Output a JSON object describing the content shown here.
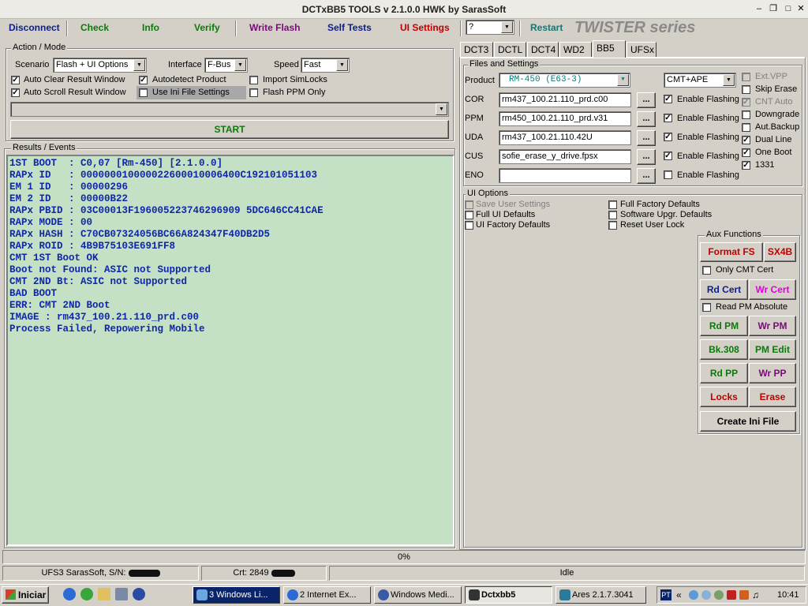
{
  "window": {
    "title": "DCTxBB5 TOOLS v 2.1.0.0 HWK by SarasSoft"
  },
  "toolbar": {
    "disconnect": "Disconnect",
    "check": "Check",
    "info": "Info",
    "verify": "Verify",
    "write_flash": "Write Flash",
    "self_tests": "Self Tests",
    "ui_settings": "UI Settings",
    "select_value": "?",
    "restart": "Restart",
    "brand": "TWISTER series"
  },
  "action_mode": {
    "title": "Action / Mode",
    "scenario_label": "Scenario",
    "scenario_value": "Flash + UI Options",
    "interface_label": "Interface",
    "interface_value": "F-Bus",
    "speed_label": "Speed",
    "speed_value": "Fast",
    "checkboxes": [
      {
        "label": "Auto Clear Result Window",
        "checked": true
      },
      {
        "label": "Autodetect Product",
        "checked": true
      },
      {
        "label": "Import SimLocks",
        "checked": false
      },
      {
        "label": "Auto Scroll Result Window",
        "checked": true
      },
      {
        "label": "Use Ini File Settings",
        "checked": false
      },
      {
        "label": "Flash PPM Only",
        "checked": false
      }
    ],
    "start_label": "START"
  },
  "results": {
    "title": "Results / Events",
    "lines": [
      "1ST BOOT  : C0,07 [Rm-450] [2.1.0.0]",
      "RAPx ID   : 000000010000022600010006400C192101051103",
      "EM 1 ID   : 00000296",
      "EM 2 ID   : 00000B22",
      "RAPx PBID : 03C00013F196005223746296909 5DC646CC41CAE",
      "RAPx MODE : 00",
      "RAPx HASH : C70CB07324056BC66A824347F40DB2D5",
      "RAPx ROID : 4B9B75103E691FF8",
      "CMT 1ST Boot OK",
      "Boot not Found: ASIC not Supported",
      "CMT 2ND Bt: ASIC not Supported",
      "BAD BOOT",
      "ERR: CMT 2ND Boot",
      "IMAGE : rm437_100.21.110_prd.c00",
      "Process Failed, Repowering Mobile"
    ]
  },
  "tabs": [
    "DCT3",
    "DCTL",
    "DCT4",
    "WD2",
    "BB5",
    "UFSx"
  ],
  "files": {
    "title": "Files and Settings",
    "product_label": "Product",
    "product_value": "RM-450  (E63-3)",
    "cmt_value": "CMT+APE",
    "rows": [
      {
        "label": "COR",
        "file": "rm437_100.21.110_prd.c00",
        "flash_label": "Enable Flashing",
        "checked": true
      },
      {
        "label": "PPM",
        "file": "rm450_100.21.110_prd.v31",
        "flash_label": "Enable Flashing",
        "checked": true
      },
      {
        "label": "UDA",
        "file": "rm437_100.21.110.42U",
        "flash_label": "Enable Flashing",
        "checked": true
      },
      {
        "label": "CUS",
        "file": "sofie_erase_y_drive.fpsx",
        "flash_label": "Enable Flashing",
        "checked": true
      },
      {
        "label": "ENO",
        "file": "",
        "flash_label": "Enable Flashing",
        "checked": false
      }
    ],
    "browse": "...",
    "side_options": [
      {
        "label": "Ext.VPP",
        "checked": false,
        "disabled": true
      },
      {
        "label": "Skip Erase",
        "checked": false,
        "disabled": false
      },
      {
        "label": "CNT Auto",
        "checked": true,
        "disabled": true
      },
      {
        "label": "Downgrade",
        "checked": false,
        "disabled": false
      },
      {
        "label": "Aut.Backup",
        "checked": false,
        "disabled": false
      },
      {
        "label": "Dual Line",
        "checked": true,
        "disabled": false
      },
      {
        "label": "One Boot",
        "checked": true,
        "disabled": false
      },
      {
        "label": "1331",
        "checked": true,
        "disabled": false
      }
    ]
  },
  "ui_options": {
    "title": "UI Options",
    "left": [
      {
        "label": "Save User Settings",
        "disabled": true
      },
      {
        "label": "Full UI Defaults",
        "disabled": false
      },
      {
        "label": "UI Factory Defaults",
        "disabled": false
      }
    ],
    "right": [
      {
        "label": "Full Factory Defaults"
      },
      {
        "label": "Software Upgr. Defaults"
      },
      {
        "label": "Reset User Lock"
      }
    ]
  },
  "aux": {
    "title": "Aux Functions",
    "format_fs": "Format FS",
    "sx4b": "SX4B",
    "only_cmt_cert": "Only CMT Cert",
    "rd_cert": "Rd Cert",
    "wr_cert": "Wr Cert",
    "read_pm_absolute": "Read PM Absolute",
    "rd_pm": "Rd PM",
    "wr_pm": "Wr PM",
    "bk308": "Bk.308",
    "pm_edit": "PM Edit",
    "rd_pp": "Rd PP",
    "wr_pp": "Wr PP",
    "locks": "Locks",
    "erase": "Erase",
    "create_ini": "Create Ini File"
  },
  "progress": {
    "text": "0%",
    "value": 0
  },
  "status": {
    "left": "UFS3 SarasSoft, S/N:",
    "middle": "Crt: 2849",
    "right": "Idle"
  },
  "taskbar": {
    "start": "Iniciar",
    "tasks": [
      "3 Windows Li...",
      "2 Internet Ex...",
      "Windows Medi...",
      "Dctxbb5",
      "Ares 2.1.7.3041"
    ],
    "lang": "PT",
    "clock": "10:41"
  },
  "colors": {
    "dark_blue": "#0a1e8c",
    "green": "#0b7a0b",
    "purple": "#7a0a7a",
    "red": "#c00000",
    "magenta": "#e000e0",
    "teal": "#0a7a7a",
    "results_bg": "#c5e1c5",
    "results_text": "#0f27a8"
  }
}
